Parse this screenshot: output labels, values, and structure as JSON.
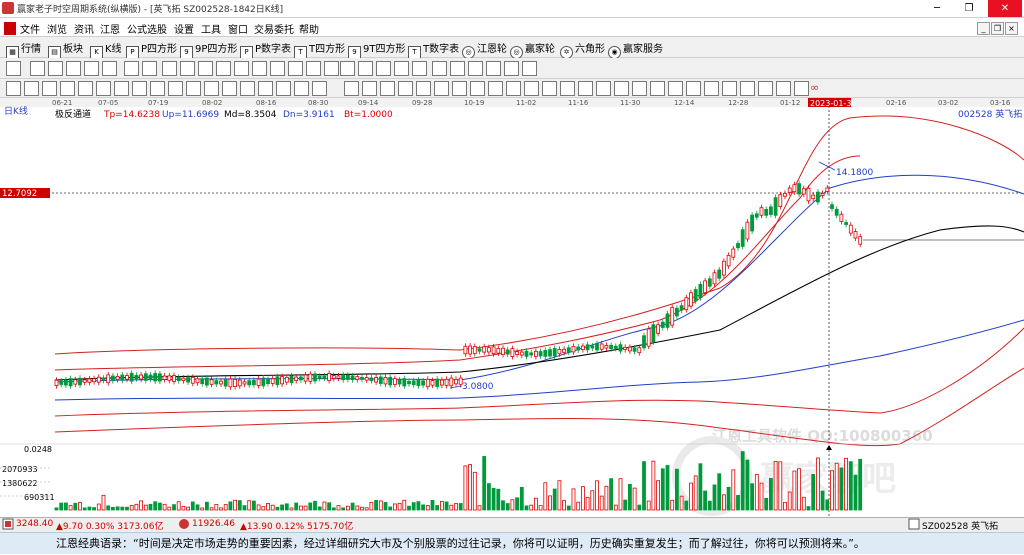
{
  "window": {
    "title": "赢家老子时空周期系统(纵横版) - [英飞拓  SZ002528-1842日K线]",
    "buttons": [
      "─",
      "❐",
      "✕"
    ]
  },
  "menubar": {
    "items": [
      "文件",
      "浏览",
      "资讯",
      "江恩",
      "公式选股",
      "设置",
      "工具",
      "窗口",
      "交易委托",
      "帮助"
    ],
    "right_buttons": [
      "_",
      "❐",
      "×"
    ]
  },
  "toolbar1": {
    "items": [
      "行情",
      "板块",
      "K线",
      "P四方形",
      "9P四方形",
      "P数字表",
      "T四方形",
      "9T四方形",
      "T数字表",
      "江恩轮",
      "赢家轮",
      "六角形",
      "赢家服务"
    ]
  },
  "chart": {
    "period_label": "日K线",
    "indicator_name": "极反通道",
    "tp": "Tp=14.6238",
    "up": "Up=11.6969",
    "md": "Md=8.3504",
    "dn": "Dn=3.9161",
    "bt": "Bt=1.0000",
    "code_name": "002528  英飞拓",
    "date_ticks": [
      "06-21",
      "07-05",
      "07-19",
      "08-02",
      "08-16",
      "08-30",
      "09-14",
      "09-28",
      "10-19",
      "11-02",
      "11-16",
      "11-30",
      "12-14",
      "12-28",
      "01-12",
      "2023-01-30",
      "02-16",
      "03-02",
      "03-16"
    ],
    "cursor_date": "2023-01-30",
    "left_price_tag": "12.7092",
    "high_label": "14.1800",
    "low_label": "3.0800",
    "vol_scale_top": "0.0248",
    "vol_ticks": [
      "2070933",
      "1380622",
      "690311"
    ],
    "watermark_1": "江恩工具软件  QQ:100800360",
    "watermark_2": "赢家聊吧"
  },
  "statusbar": {
    "sh_index": "3248.40",
    "sh_change": "▲9.70 0.30% 3173.06亿",
    "sz_index": "11926.46",
    "sz_change": "▲13.90 0.12% 5175.70亿",
    "stock_label": "SZ002528 英飞拓"
  },
  "quote": {
    "text": "江恩经典语录：“时间是决定市场走势的重要因素，经过详细研究大市及个别股票的过往记录，你将可以证明，历史确实重复发生；而了解过往，你将可以预测将来。”。"
  },
  "colors": {
    "up": "#e00000",
    "down": "#009a3d",
    "upper_band": "#d62020",
    "mid_band": "#1f3fc8",
    "center": "#000000",
    "axis_tag": "#d00000"
  }
}
